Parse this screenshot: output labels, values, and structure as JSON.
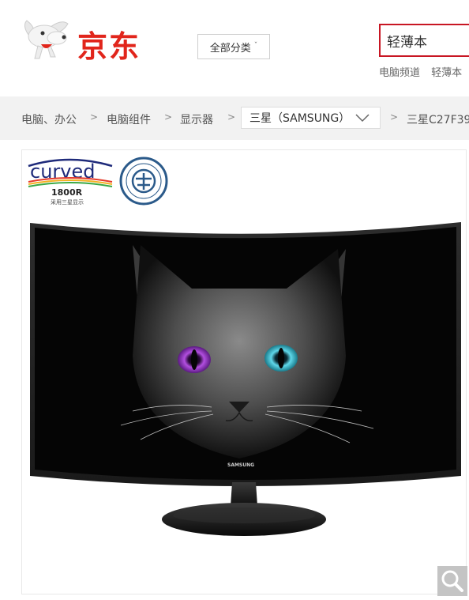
{
  "header": {
    "logo_text": "京东",
    "category_button": "全部分类",
    "search_value": "轻薄本",
    "hotwords": [
      "电脑频道",
      "轻薄本"
    ]
  },
  "breadcrumb": {
    "items": [
      "电脑、办公",
      "电脑组件",
      "显示器"
    ],
    "brand_select": "三星（SAMSUNG）",
    "product_name": "三星C27F39"
  },
  "product_image": {
    "badge_curved": "curved",
    "badge_curvature": "1800R",
    "badge_caption": "采用三星显示",
    "monitor_brand": "SAMSUNG"
  },
  "colors": {
    "brand_red": "#e1251b",
    "search_border": "#c81623",
    "crumb_bg": "#f2f2f2"
  },
  "icons": {
    "zoom": "magnifier-icon",
    "dropdown": "chevron-down-icon",
    "separator": "chevron-right-icon"
  }
}
